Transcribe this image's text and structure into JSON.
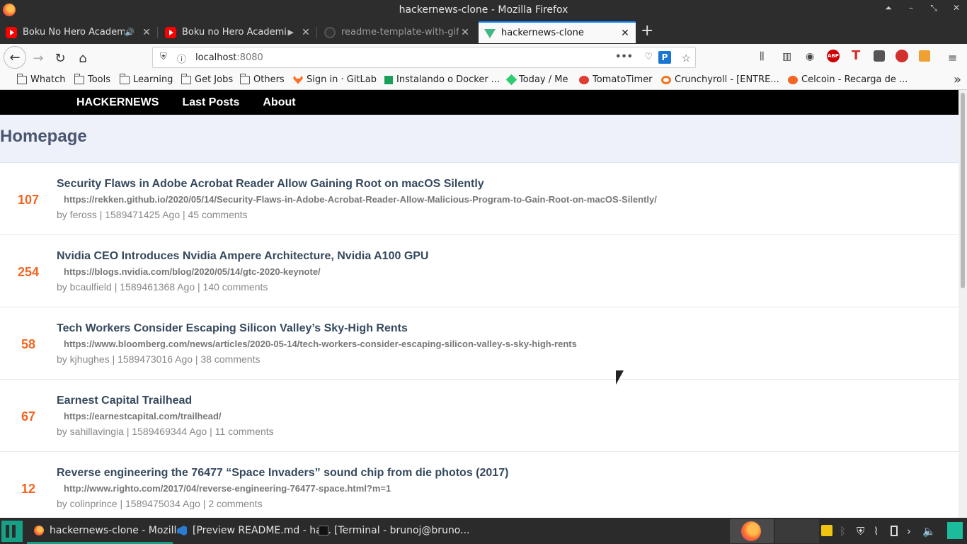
{
  "window": {
    "title": "hackernews-clone - Mozilla Firefox"
  },
  "tabs": [
    {
      "label": "Boku No Hero Academi",
      "icon": "youtube-icon",
      "audio": "speaker-icon"
    },
    {
      "label": "Boku no Hero Academi",
      "icon": "youtube-icon",
      "audio": "play-icon"
    },
    {
      "label": "readme-template-with-gif",
      "icon": "github-icon"
    },
    {
      "label": "hackernews-clone",
      "icon": "vue-icon",
      "active": true
    }
  ],
  "toolbar": {
    "url_host": "localhost",
    "url_port": ":8080"
  },
  "bookmarks": [
    {
      "label": "Whatch",
      "type": "folder"
    },
    {
      "label": "Tools",
      "type": "folder"
    },
    {
      "label": "Learning",
      "type": "folder"
    },
    {
      "label": "Get Jobs",
      "type": "folder"
    },
    {
      "label": "Others",
      "type": "folder"
    },
    {
      "label": "Sign in · GitLab",
      "type": "link",
      "color": "#fc6d26"
    },
    {
      "label": "Instalando o Docker ...",
      "type": "link",
      "color": "#18a058"
    },
    {
      "label": "Today / Me",
      "type": "link",
      "color": "#2ecc71"
    },
    {
      "label": "TomatoTimer",
      "type": "link",
      "color": "#e03c31"
    },
    {
      "label": "Crunchyroll - [ENTRE...",
      "type": "link",
      "color": "#f47521"
    },
    {
      "label": "Celcoin - Recarga de ...",
      "type": "link",
      "color": "#f26522"
    }
  ],
  "site": {
    "nav": {
      "brand": "HACKERNEWS",
      "last_posts": "Last Posts",
      "about": "About"
    },
    "page_title": "Homepage",
    "accent_color": "#f26522",
    "posts": [
      {
        "score": "107",
        "title": "Security Flaws in Adobe Acrobat Reader Allow Gaining Root on macOS Silently",
        "url": "https://rekken.github.io/2020/05/14/Security-Flaws-in-Adobe-Acrobat-Reader-Allow-Malicious-Program-to-Gain-Root-on-macOS-Silently/",
        "meta": "by feross | 1589471425 Ago | 45 comments"
      },
      {
        "score": "254",
        "title": "Nvidia CEO Introduces Nvidia Ampere Architecture, Nvidia A100 GPU",
        "url": "https://blogs.nvidia.com/blog/2020/05/14/gtc-2020-keynote/",
        "meta": "by bcaulfield | 1589461368 Ago | 140 comments"
      },
      {
        "score": "58",
        "title": "Tech Workers Consider Escaping Silicon Valley’s Sky-High Rents",
        "url": "https://www.bloomberg.com/news/articles/2020-05-14/tech-workers-consider-escaping-silicon-valley-s-sky-high-rents",
        "meta": "by kjhughes | 1589473016 Ago | 38 comments"
      },
      {
        "score": "67",
        "title": "Earnest Capital Trailhead",
        "url": "https://earnestcapital.com/trailhead/",
        "meta": "by sahillavingia | 1589469344 Ago | 11 comments"
      },
      {
        "score": "12",
        "title": "Reverse engineering the 76477 “Space Invaders” sound chip from die photos (2017)",
        "url": "http://www.righto.com/2017/04/reverse-engineering-76477-space.html?m=1",
        "meta": "by colinprince | 1589475034 Ago | 2 comments"
      }
    ]
  },
  "taskbar": {
    "items": [
      {
        "label": "hackernews-clone - Mozill...",
        "icon": "firefox-icon"
      },
      {
        "label": "[Preview README.md - ha...",
        "icon": "vscode-icon"
      },
      {
        "label": "[Terminal - brunoj@bruno...",
        "icon": "terminal-icon"
      }
    ]
  }
}
